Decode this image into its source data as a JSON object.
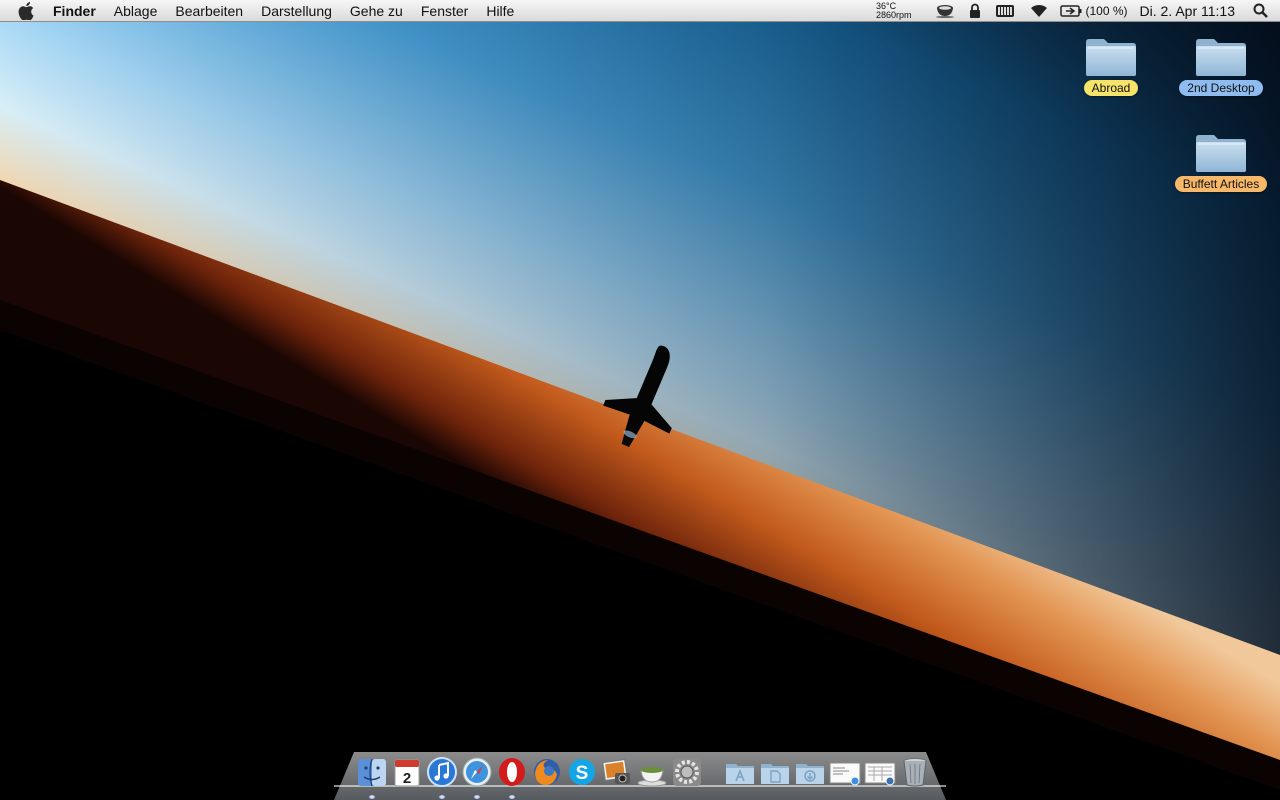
{
  "menubar": {
    "app_name": "Finder",
    "menus": [
      "Ablage",
      "Bearbeiten",
      "Darstellung",
      "Gehe zu",
      "Fenster",
      "Hilfe"
    ],
    "temperature": "36°C",
    "fan_speed": "2860rpm",
    "battery_percent": "(100 %)",
    "clock": "Di. 2. Apr  11:13",
    "status_icons": [
      "coffee-cup-icon",
      "lock-icon",
      "keyboard-icon",
      "wifi-icon",
      "battery-icon",
      "spotlight-icon"
    ]
  },
  "desktop": {
    "icons": [
      {
        "label": "Abroad",
        "label_color": "#f5e36a",
        "icon": "folder-icon"
      },
      {
        "label": "2nd Desktop",
        "label_color": "#8fbcf0",
        "icon": "folder-icon"
      },
      {
        "label": "Buffett Articles",
        "label_color": "#f7b86a",
        "icon": "folder-icon"
      }
    ]
  },
  "dock": {
    "apps": [
      {
        "name": "Finder",
        "icon": "finder-icon",
        "running": true
      },
      {
        "name": "iCal",
        "icon": "calendar-icon",
        "text": "2",
        "running": false
      },
      {
        "name": "iTunes",
        "icon": "itunes-icon",
        "running": true
      },
      {
        "name": "Safari",
        "icon": "safari-icon",
        "running": true
      },
      {
        "name": "Opera",
        "icon": "opera-icon",
        "running": true
      },
      {
        "name": "Firefox",
        "icon": "firefox-icon",
        "running": false
      },
      {
        "name": "Skype",
        "icon": "skype-icon",
        "running": false
      },
      {
        "name": "iPhoto",
        "icon": "iphoto-icon",
        "running": false
      },
      {
        "name": "Caffeine",
        "icon": "coffee-cup-icon",
        "running": false
      },
      {
        "name": "System Preferences",
        "icon": "system-preferences-icon",
        "running": false
      }
    ],
    "stacks": [
      {
        "name": "Applications",
        "icon": "applications-folder-icon"
      },
      {
        "name": "Documents",
        "icon": "documents-folder-icon"
      },
      {
        "name": "Downloads",
        "icon": "downloads-folder-icon"
      },
      {
        "name": "Mail",
        "icon": "mail-document-icon"
      },
      {
        "name": "Preview",
        "icon": "preview-document-icon"
      },
      {
        "name": "Trash",
        "icon": "trash-icon"
      }
    ]
  },
  "colors": {
    "menubar_bg": "#e6e6e6",
    "sky_top": "#0b2a4a",
    "sky_light": "#bfe6fb",
    "horizon_orange": "#c8621f",
    "earth_dark": "#000000"
  }
}
